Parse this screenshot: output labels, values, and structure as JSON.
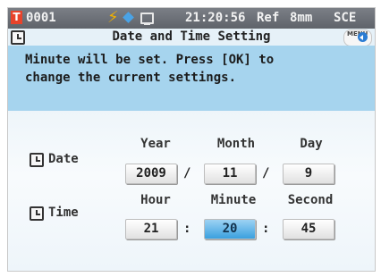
{
  "status_bar": {
    "channel": "0001",
    "channel_icon": "T-icon",
    "time": "21:20:56",
    "mode": "Ref",
    "aperture": "8mm",
    "specular": "SCE",
    "icons": [
      "bolt-icon",
      "diamond-icon",
      "monitor-icon"
    ]
  },
  "title_bar": {
    "title": "Date and Time Setting",
    "menu_label": "MENU"
  },
  "message": {
    "line1": "Minute will be set. Press [OK] to",
    "line2": "change the current settings."
  },
  "date": {
    "label": "Date",
    "year_header": "Year",
    "month_header": "Month",
    "day_header": "Day",
    "year": "2009",
    "month": "11",
    "day": "9",
    "separator": "/"
  },
  "time": {
    "label": "Time",
    "hour_header": "Hour",
    "minute_header": "Minute",
    "second_header": "Second",
    "hour": "21",
    "minute": "20",
    "second": "45",
    "separator": ":"
  },
  "colors": {
    "accent_active": "#3aa0df",
    "message_bg": "#a6d4ee",
    "channel_red": "#e8432b"
  }
}
